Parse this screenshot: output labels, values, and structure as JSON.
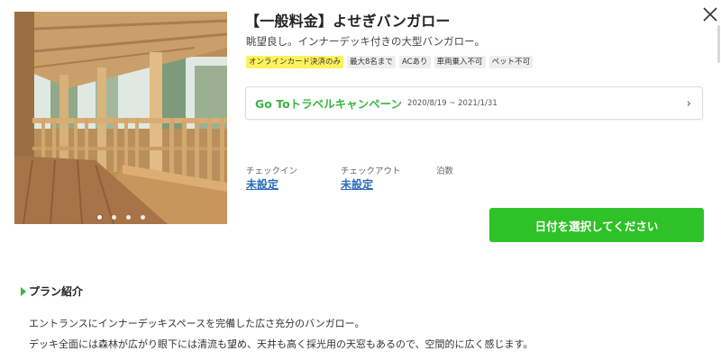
{
  "listing": {
    "title": "【一般料金】よせぎバンガロー",
    "description": "眺望良し。インナーデッキ付きの大型バンガロー。",
    "tags": [
      "オンラインカード決済のみ",
      "最大8名まで",
      "ACあり",
      "車両乗入不可",
      "ペット不可"
    ],
    "highlight_tag_color": "#fff35c"
  },
  "gallery": {
    "slide_count": 4,
    "active_slide": 1
  },
  "campaign": {
    "name": "Go Toトラベルキャンペーン",
    "period": "2020/8/19 ~ 2021/1/31",
    "chevron": "›"
  },
  "booking": {
    "checkin_label": "チェックイン",
    "checkin_value": "未設定",
    "checkout_label": "チェックアウト",
    "checkout_value": "未設定",
    "nights_label": "泊数",
    "cta_label": "日付を選択してください"
  },
  "plan": {
    "heading": "プラン紹介",
    "lines": [
      "エントランスにインナーデッキスペースを完備した広さ充分のバンガロー。",
      "デッキ全面には森林が広がり眼下には清流も望め、天井も高く採光用の天窓もあるので、空間的に広く感じます。"
    ]
  },
  "colors": {
    "accent_green": "#2ec227",
    "link_blue": "#2a6db6"
  },
  "icons": {
    "close": "close-icon",
    "heading_marker": "triangle-right-icon"
  }
}
